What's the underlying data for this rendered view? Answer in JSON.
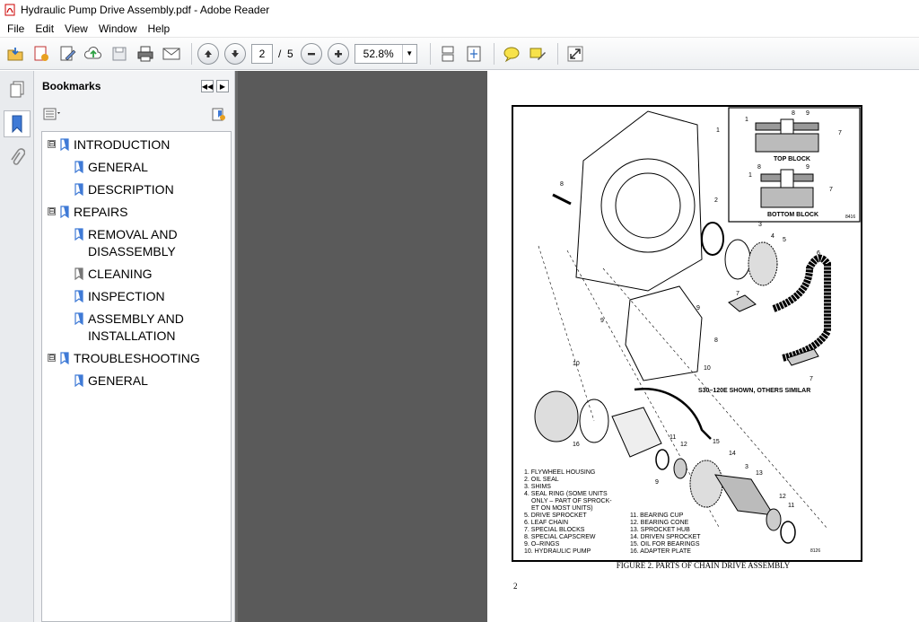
{
  "window": {
    "title": "Hydraulic Pump Drive Assembly.pdf - Adobe Reader"
  },
  "menu": [
    "File",
    "Edit",
    "View",
    "Window",
    "Help"
  ],
  "toolbar": {
    "current_page": "2",
    "page_total": "/  5",
    "zoom": "52.8%"
  },
  "bookmarks": {
    "title": "Bookmarks",
    "items": [
      {
        "label": "INTRODUCTION",
        "level": 0,
        "toggle": "⊟"
      },
      {
        "label": "GENERAL",
        "level": 1
      },
      {
        "label": "DESCRIPTION",
        "level": 1
      },
      {
        "label": "REPAIRS",
        "level": 0,
        "toggle": "⊟"
      },
      {
        "label": "REMOVAL AND",
        "label2": "DISASSEMBLY",
        "level": 1
      },
      {
        "label": "CLEANING",
        "level": 1
      },
      {
        "label": "INSPECTION",
        "level": 1
      },
      {
        "label": "ASSEMBLY AND",
        "label2": "INSTALLATION",
        "level": 1
      },
      {
        "label": "TROUBLESHOOTING",
        "level": 0,
        "toggle": "⊟"
      },
      {
        "label": "GENERAL",
        "level": 1
      }
    ]
  },
  "document": {
    "inset": {
      "top_label": "TOP BLOCK",
      "bottom_label": "BOTTOM BLOCK",
      "code": "8416"
    },
    "note": "S30–120E SHOWN, OTHERS SIMILAR",
    "legend_left": [
      "1. FLYWHEEL HOUSING",
      "2. OIL SEAL",
      "3. SHIMS",
      "4. SEAL RING (SOME UNITS",
      "ONLY – PART OF SPROCK-",
      "ET ON MOST UNITS)",
      "5. DRIVE SPROCKET",
      "6. LEAF CHAIN",
      "7. SPECIAL BLOCKS",
      "8. SPECIAL CAPSCREW",
      "9. O–RINGS",
      "10. HYDRAULIC PUMP"
    ],
    "legend_right": [
      "11. BEARING CUP",
      "12. BEARING CONE",
      "13. SPROCKET HUB",
      "14. DRIVEN SPROCKET",
      "15. OIL FOR BEARINGS",
      "16. ADAPTER PLATE"
    ],
    "figure_code": "8126",
    "caption": "FIGURE 2. PARTS OF CHAIN DRIVE ASSEMBLY",
    "page_number": "2",
    "callouts": [
      "1",
      "2",
      "3",
      "4",
      "5",
      "6",
      "7",
      "8",
      "9",
      "10",
      "11",
      "12",
      "13",
      "14",
      "15",
      "16"
    ]
  }
}
